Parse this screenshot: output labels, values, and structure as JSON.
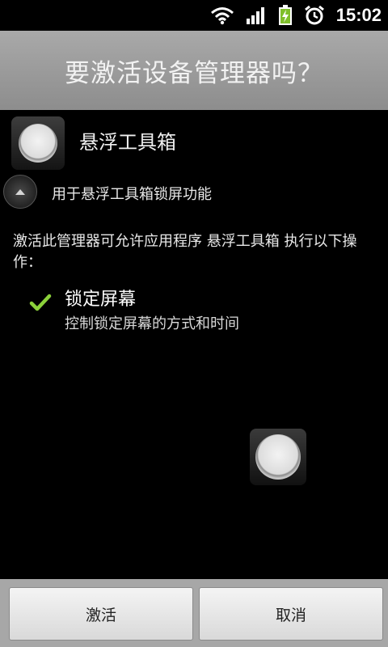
{
  "status_bar": {
    "time": "15:02",
    "icons": [
      "wifi-icon",
      "signal-icon",
      "battery-charging-icon",
      "alarm-icon"
    ]
  },
  "dialog": {
    "title": "要激活设备管理器吗？",
    "app_name": "悬浮工具箱",
    "app_description": "用于悬浮工具箱锁屏功能",
    "warning_text": "激活此管理器可允许应用程序 悬浮工具箱 执行以下操作：",
    "permission": {
      "title": "锁定屏幕",
      "description": "控制锁定屏幕的方式和时间"
    },
    "buttons": {
      "activate": "激活",
      "cancel": "取消"
    }
  },
  "colors": {
    "title_bar": "#9b9b9b",
    "check_green": "#8bd13a",
    "background": "#000000",
    "bottom_bar": "#a7a7a7"
  }
}
